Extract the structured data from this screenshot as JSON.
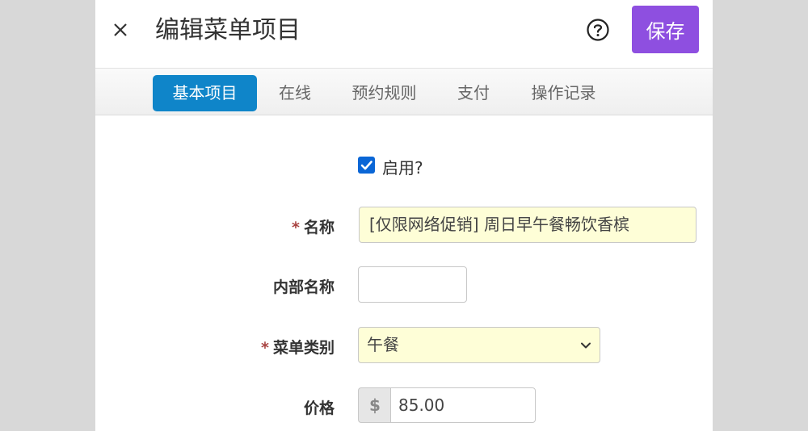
{
  "header": {
    "title": "编辑菜单项目",
    "save_label": "保存"
  },
  "tabs": [
    {
      "label": "基本项目",
      "active": true
    },
    {
      "label": "在线",
      "active": false
    },
    {
      "label": "预约规则",
      "active": false
    },
    {
      "label": "支付",
      "active": false
    },
    {
      "label": "操作记录",
      "active": false
    }
  ],
  "form": {
    "enabled": {
      "label": "启用?",
      "checked": true
    },
    "name": {
      "required_mark": "*",
      "label": "名称",
      "value": "[仅限网络促销] 周日早午餐畅饮香槟"
    },
    "internal_name": {
      "label": "内部名称",
      "value": ""
    },
    "category": {
      "required_mark": "*",
      "label": "菜单类别",
      "value": "午餐"
    },
    "price": {
      "label": "价格",
      "currency": "$",
      "value": "85.00"
    }
  },
  "colors": {
    "save_button": "#8e4fe0",
    "active_tab": "#0f85c9",
    "checkbox": "#0a66d6",
    "highlight_field": "#fefed7",
    "required_mark": "#a94442"
  },
  "icons": {
    "close": "close-icon",
    "help": "help-circle-icon",
    "dropdown": "chevron-down-icon",
    "check": "checkmark-icon"
  }
}
